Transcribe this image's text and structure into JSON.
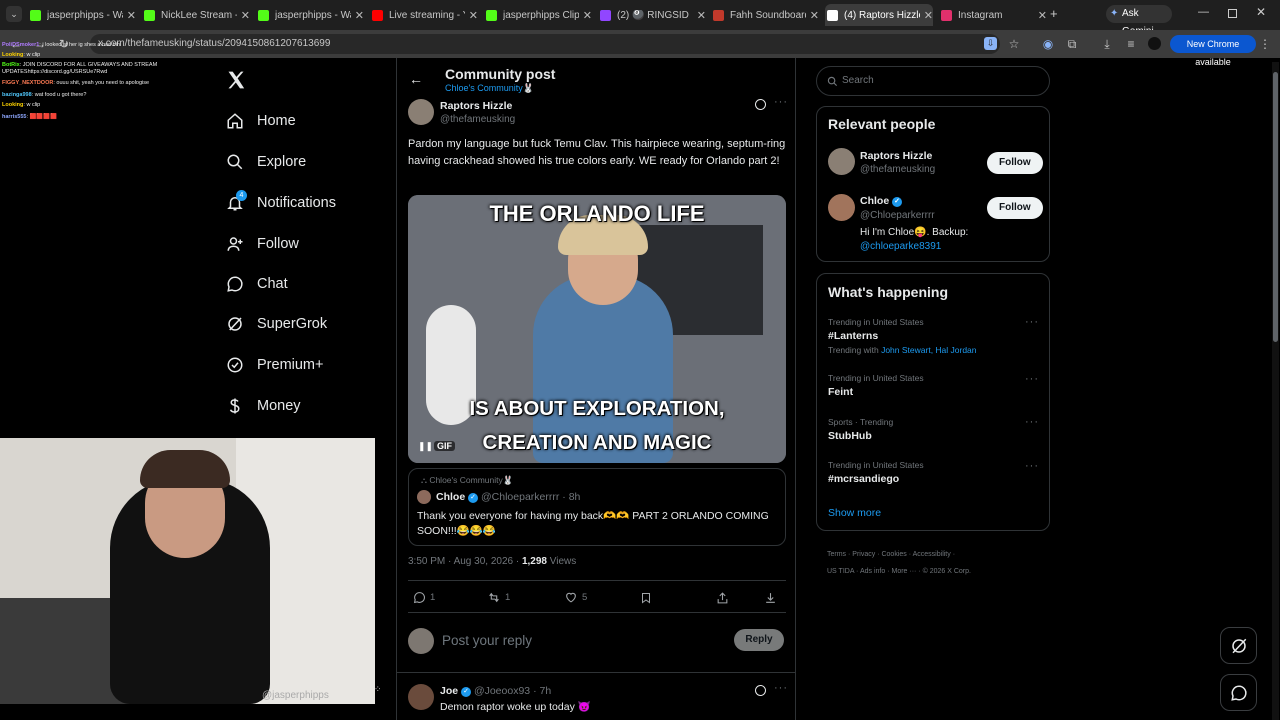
{
  "browser": {
    "tabs": [
      {
        "title": "jasperphipps - Wa",
        "icon": "kick-icon",
        "color": "#53fc18"
      },
      {
        "title": "NickLee Stream - K",
        "icon": "kick-icon",
        "color": "#53fc18"
      },
      {
        "title": "jasperphipps - Wa",
        "icon": "kick-icon",
        "color": "#53fc18"
      },
      {
        "title": "Live streaming - Yo",
        "icon": "youtube-icon",
        "color": "#ff0000"
      },
      {
        "title": "jasperphipps Clips",
        "icon": "kick-icon",
        "color": "#53fc18"
      },
      {
        "title": "(2) 🎱 RINGSID",
        "icon": "twitch-icon",
        "color": "#9146ff"
      },
      {
        "title": "Fahh Soundboard",
        "icon": "soundboard-icon",
        "color": "#c0392b"
      },
      {
        "title": "(4) Raptors Hizzle",
        "icon": "x-icon",
        "color": "#ffffff"
      },
      {
        "title": "Instagram",
        "icon": "instagram-icon",
        "color": "#e1306c"
      }
    ],
    "new_tab": "+",
    "ask_gemini": "Ask Gemini",
    "url": "x.com/thefameusking/status/2094150861207613699",
    "new_chrome": "New Chrome available"
  },
  "stream_chat": [
    {
      "user": "PoliDSmoker1",
      "text": "i looked at her ig shes a bad bih",
      "color": "#b07cff"
    },
    {
      "user": "Looking",
      "text": "w clip",
      "color": "#ffd400"
    },
    {
      "user": "BotRix",
      "text": "JOIN DISCORD FOR ALL GIVEAWAYS AND STREAM UPDATEShttps://discord.gg/USRSUe7Rwd",
      "color": "#53fc18"
    },
    {
      "user": "FIGGY_NEXTDOOR",
      "text": "ouuu shit, yeah you need to apologise",
      "color": "#ff7b54"
    },
    {
      "user": "bazinga998",
      "text": "wat food u got there?",
      "color": "#4fc3f7"
    },
    {
      "user": "Looking",
      "text": "w clip",
      "color": "#ffd400"
    },
    {
      "user": "harris555",
      "text": "🟥🟥🟥🟥",
      "color": "#8fa8ff"
    }
  ],
  "x_nav": {
    "logo": "X",
    "items": [
      {
        "label": "Home",
        "icon": "home-icon"
      },
      {
        "label": "Explore",
        "icon": "search-icon"
      },
      {
        "label": "Notifications",
        "icon": "bell-icon",
        "badge": "4"
      },
      {
        "label": "Follow",
        "icon": "follow-icon"
      },
      {
        "label": "Chat",
        "icon": "chat-icon"
      },
      {
        "label": "SuperGrok",
        "icon": "grok-icon"
      },
      {
        "label": "Premium+",
        "icon": "premium-icon"
      },
      {
        "label": "Money",
        "icon": "money-icon"
      }
    ]
  },
  "webcam": {
    "handle": "@jasperphipps"
  },
  "post_header": {
    "title": "Community post",
    "community": "Chloe's Community🐰"
  },
  "post": {
    "author": "Raptors Hizzle",
    "handle": "@thefameusking",
    "text": "Pardon my language but fuck Temu Clav. This hairpiece wearing, septum-ring having crackhead showed his true colors early. WE ready for Orlando part 2!",
    "media_top": "THE ORLANDO LIFE",
    "media_bottom1": "IS ABOUT EXPLORATION,",
    "media_bottom2": "CREATION AND MAGIC",
    "gif_badge": "GIF",
    "quote": {
      "community": "Chloe's Community🐰",
      "author": "Chloe",
      "handle": "@Chloeparkerrrr",
      "time": "· 8h",
      "text": "Thank you everyone for having my back🫶🫶 PART 2 ORLANDO COMING SOON!!!😂😂😂"
    },
    "timestamp": "3:50 PM · Aug 30, 2026 · ",
    "views": "1,298",
    "views_label": " Views",
    "replies": "1",
    "reposts": "1",
    "likes": "5"
  },
  "reply_box": {
    "placeholder": "Post your reply",
    "button": "Reply"
  },
  "reply": {
    "author": "Joe",
    "handle": "@Joeoox93",
    "time": "· 7h",
    "text": "Demon raptor woke up today 😈"
  },
  "search": {
    "placeholder": "Search"
  },
  "relevant": {
    "title": "Relevant people",
    "people": [
      {
        "name": "Raptors Hizzle",
        "handle": "@thefameusking",
        "button": "Follow"
      },
      {
        "name": "Chloe",
        "handle": "@Chloeparkerrrr",
        "button": "Follow",
        "bio": "Hi I'm Chloe😝. Backup: ",
        "bio_link": "@chloeparke8391"
      }
    ]
  },
  "happening": {
    "title": "What's happening",
    "trends": [
      {
        "label": "Trending in United States",
        "name": "#Lanterns",
        "with_label": "Trending with ",
        "with": "John Stewart, Hal Jordan"
      },
      {
        "label": "Trending in United States",
        "name": "Feint"
      },
      {
        "label": "Sports · Trending",
        "name": "StubHub"
      },
      {
        "label": "Trending in United States",
        "name": "#mcrsandiego"
      }
    ],
    "show_more": "Show more"
  },
  "footer": {
    "line1": [
      "Terms",
      "Privacy",
      "Cookies",
      "Accessibility"
    ],
    "line2": [
      "US TIDA",
      "Ads info",
      "More ···",
      "© 2026 X Corp."
    ]
  },
  "colors": {
    "accent": "#1d9bf0",
    "background": "#000000",
    "border": "#2f3336",
    "muted": "#71767b"
  }
}
